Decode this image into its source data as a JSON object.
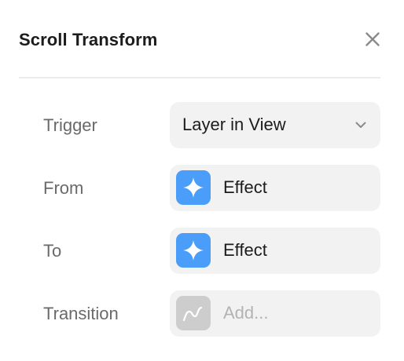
{
  "panel": {
    "title": "Scroll Transform",
    "close_icon": "close-icon"
  },
  "rows": {
    "trigger": {
      "label": "Trigger",
      "value": "Layer in View",
      "icon": "chevron-down-icon"
    },
    "from": {
      "label": "From",
      "value": "Effect",
      "icon": "sparkle-icon"
    },
    "to": {
      "label": "To",
      "value": "Effect",
      "icon": "sparkle-icon"
    },
    "transition": {
      "label": "Transition",
      "placeholder": "Add...",
      "icon": "curve-icon"
    }
  },
  "colors": {
    "accent": "#4a9df8",
    "field_background": "#f2f2f2",
    "placeholder_tile": "#cdcdcd",
    "placeholder_text": "#b3b3b3"
  }
}
